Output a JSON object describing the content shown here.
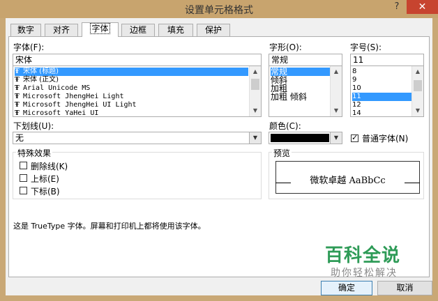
{
  "window": {
    "title": "设置单元格格式",
    "help": "?",
    "close": "✕"
  },
  "tabs": [
    {
      "label": "数字"
    },
    {
      "label": "对齐"
    },
    {
      "label": "字体"
    },
    {
      "label": "边框"
    },
    {
      "label": "填充"
    },
    {
      "label": "保护"
    }
  ],
  "active_tab": "字体",
  "font": {
    "label": "字体(F):",
    "value": "宋体",
    "items": [
      {
        "label": "宋体 (标题)",
        "selected": true
      },
      {
        "label": "宋体 (正文)",
        "selected": false
      },
      {
        "label": "Arial Unicode MS",
        "selected": false
      },
      {
        "label": "Microsoft JhengHei Light",
        "selected": false
      },
      {
        "label": "Microsoft JhengHei UI Light",
        "selected": false
      },
      {
        "label": "Microsoft YaHei UI",
        "selected": false
      }
    ],
    "truetype_glyph": "Ŧ"
  },
  "style": {
    "label": "字形(O):",
    "value": "常规",
    "items": [
      {
        "label": "常规",
        "selected": true
      },
      {
        "label": "倾斜",
        "selected": false
      },
      {
        "label": "加粗",
        "selected": false
      },
      {
        "label": "加粗 倾斜",
        "selected": false
      }
    ]
  },
  "size": {
    "label": "字号(S):",
    "value": "11",
    "items": [
      {
        "label": "8",
        "selected": false
      },
      {
        "label": "9",
        "selected": false
      },
      {
        "label": "10",
        "selected": false
      },
      {
        "label": "11",
        "selected": true
      },
      {
        "label": "12",
        "selected": false
      },
      {
        "label": "14",
        "selected": false
      }
    ]
  },
  "underline": {
    "label": "下划线(U):",
    "value": "无"
  },
  "color": {
    "label": "颜色(C):",
    "swatch": "#000000"
  },
  "normal_font": {
    "label": "普通字体(N)",
    "checked": true
  },
  "effects": {
    "title": "特殊效果",
    "items": [
      {
        "label": "删除线(K)",
        "checked": false
      },
      {
        "label": "上标(E)",
        "checked": false
      },
      {
        "label": "下标(B)",
        "checked": false
      }
    ]
  },
  "preview": {
    "title": "预览",
    "text": "微软卓越  AaBbCc"
  },
  "description": "这是 TrueType 字体。屏幕和打印机上都将使用该字体。",
  "buttons": {
    "ok": "确定",
    "cancel": "取消"
  },
  "watermark": {
    "main": "百科全说",
    "sub": "助你轻松解决"
  },
  "arrows": {
    "up": "▲",
    "down": "▼"
  }
}
